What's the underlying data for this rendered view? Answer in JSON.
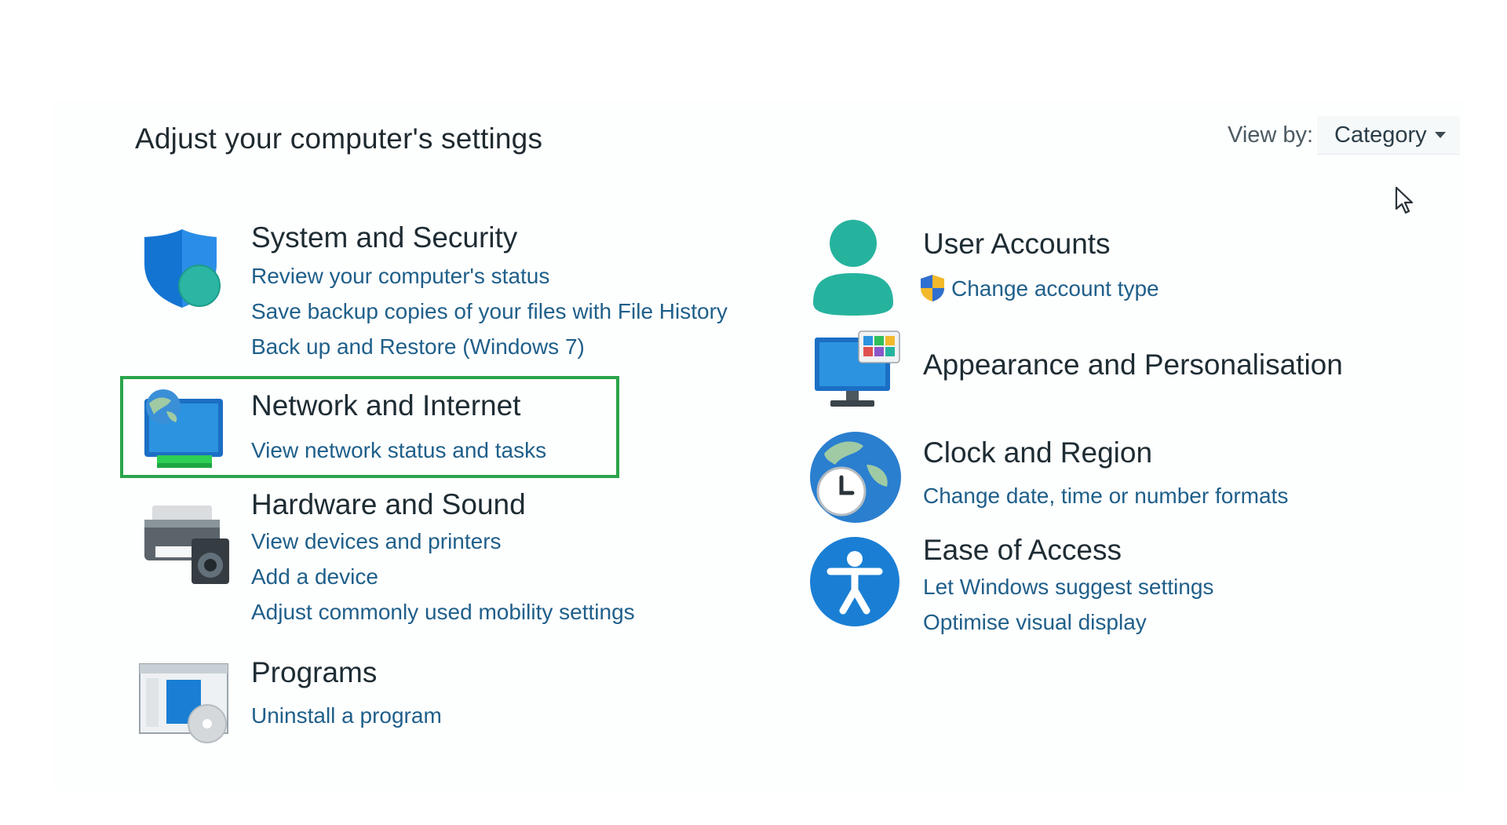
{
  "page": {
    "title": "Adjust your computer's settings"
  },
  "view_by": {
    "label": "View by:",
    "value": "Category"
  },
  "categories": {
    "system_security": {
      "title": "System and Security",
      "links": [
        "Review your computer's status",
        "Save backup copies of your files with File History",
        "Back up and Restore (Windows 7)"
      ],
      "icon": "shield-icon"
    },
    "network_internet": {
      "title": "Network and Internet",
      "links": [
        "View network status and tasks"
      ],
      "icon": "network-globe-icon",
      "highlighted": true,
      "highlight_color": "#2aa44a"
    },
    "hardware_sound": {
      "title": "Hardware and Sound",
      "links": [
        "View devices and printers",
        "Add a device",
        "Adjust commonly used mobility settings"
      ],
      "icon": "printer-speaker-icon"
    },
    "programs": {
      "title": "Programs",
      "links": [
        "Uninstall a program"
      ],
      "icon": "programs-disc-icon"
    },
    "user_accounts": {
      "title": "User Accounts",
      "links": [
        "Change account type"
      ],
      "icon": "user-icon",
      "link_icon": "uac-shield-icon"
    },
    "appearance": {
      "title": "Appearance and Personalisation",
      "links": [],
      "icon": "monitor-palette-icon"
    },
    "clock_region": {
      "title": "Clock and Region",
      "links": [
        "Change date, time or number formats"
      ],
      "icon": "clock-globe-icon"
    },
    "ease_access": {
      "title": "Ease of Access",
      "links": [
        "Let Windows suggest settings",
        "Optimise visual display"
      ],
      "icon": "accessibility-icon"
    }
  },
  "colors": {
    "link": "#1f5f8a",
    "title": "#1e2c33",
    "accent_blue": "#1a7fd4",
    "teal": "#2bb6a3"
  }
}
